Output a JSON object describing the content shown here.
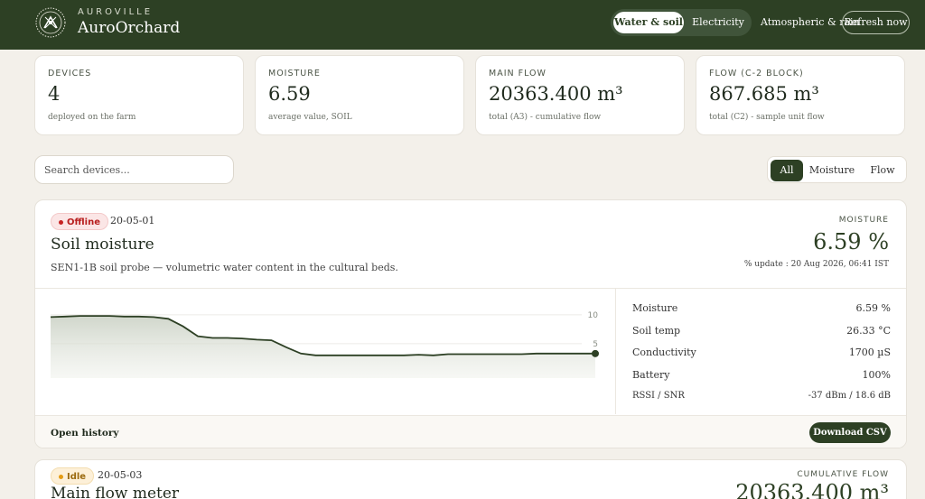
{
  "header": {
    "brand_small": "AUROVILLE",
    "brand_name": "AuroOrchard",
    "tabs": [
      {
        "label": "Water & soil",
        "active": true
      },
      {
        "label": "Electricity",
        "active": false
      }
    ],
    "nav_link": "Atmospheric & rain",
    "refresh_label": "Refresh now"
  },
  "stats": [
    {
      "label": "DEVICES",
      "value": "4",
      "sub": "deployed on the farm"
    },
    {
      "label": "MOISTURE",
      "value": "6.59",
      "sub": "average value, SOIL"
    },
    {
      "label": "MAIN FLOW",
      "value": "20363.400 m³",
      "sub": "total (A3) - cumulative flow"
    },
    {
      "label": "FLOW (C-2 BLOCK)",
      "value": "867.685 m³",
      "sub": "total (C2) - sample unit flow"
    }
  ],
  "search": {
    "placeholder": "Search devices..."
  },
  "filters": [
    {
      "label": "All",
      "active": true
    },
    {
      "label": "Moisture",
      "active": false
    },
    {
      "label": "Flow",
      "active": false
    }
  ],
  "devices": [
    {
      "status": "Offline",
      "id": "20-05-01",
      "title": "Soil moisture",
      "description": "SEN1-1B soil probe — volumetric water content in the cultural beds.",
      "metric_label": "MOISTURE",
      "metric_value": "6.59 %",
      "updated": "% update : 20 Aug 2026, 06:41 IST",
      "chart_data": {
        "type": "area",
        "y_ticks": [
          "10",
          "5"
        ],
        "ylim": [
          0,
          12
        ],
        "values": [
          9.6,
          9.7,
          9.8,
          9.8,
          9.8,
          9.7,
          9.7,
          9.6,
          9.3,
          8.0,
          6.3,
          6.0,
          6.0,
          5.9,
          5.7,
          5.6,
          4.4,
          3.3,
          3.0,
          3.0,
          3.0,
          3.0,
          3.0,
          3.0,
          3.0,
          3.1,
          3.0,
          3.2,
          3.2,
          3.2,
          3.2,
          3.2,
          3.2,
          3.3,
          3.3,
          3.3,
          3.3,
          3.3
        ]
      },
      "readings": [
        {
          "label": "Moisture",
          "value": "6.59 %"
        },
        {
          "label": "Soil temp",
          "value": "26.33 °C"
        },
        {
          "label": "Conductivity",
          "value": "1700 µS"
        },
        {
          "label": "Battery",
          "value": "100%"
        },
        {
          "label": "RSSI / SNR",
          "value": "-37 dBm / 18.6 dB"
        }
      ],
      "footer_link": "Open history",
      "download_label": "Download CSV"
    },
    {
      "status": "Idle",
      "id": "20-05-03",
      "title": "Main flow meter",
      "metric_label": "CUMULATIVE FLOW",
      "metric_value": "20363.400 m³"
    }
  ]
}
